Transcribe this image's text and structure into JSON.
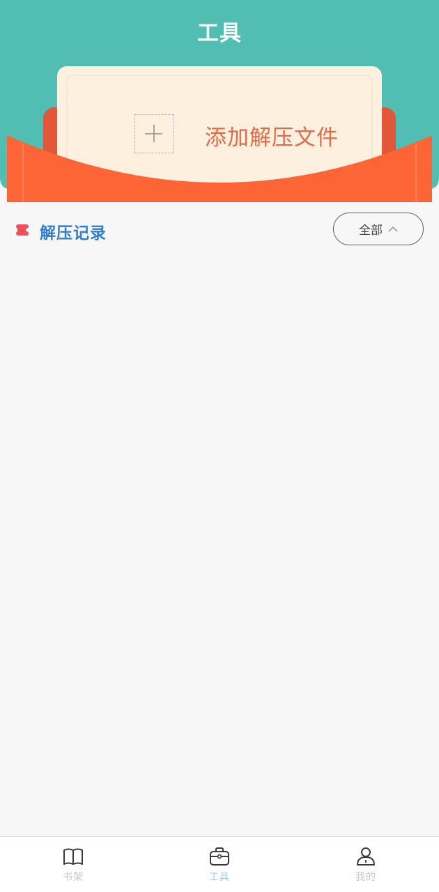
{
  "header": {
    "title": "工具"
  },
  "add_card": {
    "label": "添加解压文件",
    "icon": "plus-icon"
  },
  "records": {
    "title": "解压记录",
    "filter_label": "全部",
    "filter_icon": "chevron-up-icon",
    "items": []
  },
  "tabbar": {
    "active_index": 1,
    "items": [
      {
        "label": "书架",
        "icon": "book-icon"
      },
      {
        "label": "工具",
        "icon": "toolbox-icon"
      },
      {
        "label": "我的",
        "icon": "user-icon"
      }
    ]
  },
  "colors": {
    "teal": "#51bdb3",
    "orange": "#fe6536",
    "card_cream": "#fdf0df",
    "accent_blue": "#2f7fd0",
    "label_orange": "#e16b49"
  }
}
